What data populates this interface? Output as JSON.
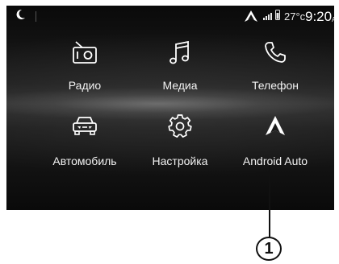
{
  "status_bar": {
    "temperature": "27°c",
    "time": "9:20",
    "ampm": "A"
  },
  "tiles": [
    {
      "label": "Радио",
      "icon": "radio-icon"
    },
    {
      "label": "Медиа",
      "icon": "music-note-icon"
    },
    {
      "label": "Телефон",
      "icon": "phone-icon"
    },
    {
      "label": "Автомобиль",
      "icon": "car-icon"
    },
    {
      "label": "Настройка",
      "icon": "gear-icon"
    },
    {
      "label": "Android Auto",
      "icon": "android-auto-icon"
    }
  ],
  "callout": {
    "number": "1"
  },
  "colors": {
    "screen_bg": "#141414",
    "text": "#ffffff",
    "callout": "#111111"
  }
}
